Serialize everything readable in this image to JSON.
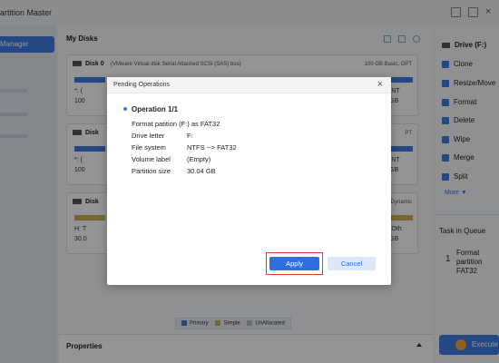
{
  "app": {
    "title": "artition Master"
  },
  "leftnav": {
    "active_label": "Manager"
  },
  "main": {
    "title": "My Disks",
    "disks": [
      {
        "name": "Disk 0",
        "info": "(VMware   Virtual disk    Serial Attached SCSI (SAS) bus)",
        "right": "100 GB Basic, GPT",
        "part_left": "*: (",
        "part_left2": "100",
        "part_right": "(NT",
        "part_right2": "GB"
      },
      {
        "name": "Disk",
        "right": "PT",
        "part_left": "*: (",
        "part_left2": "100",
        "part_right": "(NT",
        "part_right2": "GB"
      },
      {
        "name": "Disk",
        "right": "Dynamic",
        "part_left": "H: T",
        "part_left2": "30.0",
        "part_right": "(Oth",
        "part_right2": "GB"
      }
    ],
    "legend": {
      "primary": "Primary",
      "simple": "Simple",
      "unallocated": "UnAllocated"
    },
    "properties": "Properties"
  },
  "right": {
    "items": [
      "Drive (F:)",
      "Clone",
      "Resize/Move",
      "Format",
      "Delete",
      "Wipe",
      "Merge",
      "Split"
    ],
    "more": "More ▼",
    "queue_title": "Task in Queue",
    "queue_num": "1",
    "queue_text": "Format partition FAT32",
    "execute": "Execute"
  },
  "dialog": {
    "title": "Pending Operations",
    "close": "×",
    "op_title": "Operation 1/1",
    "op_desc": "Format patition (F:) as FAT32",
    "rows": [
      {
        "k": "Drive letter",
        "v": "F:"
      },
      {
        "k": "File system",
        "v": "NTFS --> FAT32"
      },
      {
        "k": "Volume label",
        "v": "(Empty)"
      },
      {
        "k": "Partition size",
        "v": "30.04 GB"
      }
    ],
    "apply": "Apply",
    "cancel": "Cancel"
  },
  "colors": {
    "accent": "#3d7de4",
    "highlight": "#e23a3a",
    "simple": "#c7b45b"
  }
}
